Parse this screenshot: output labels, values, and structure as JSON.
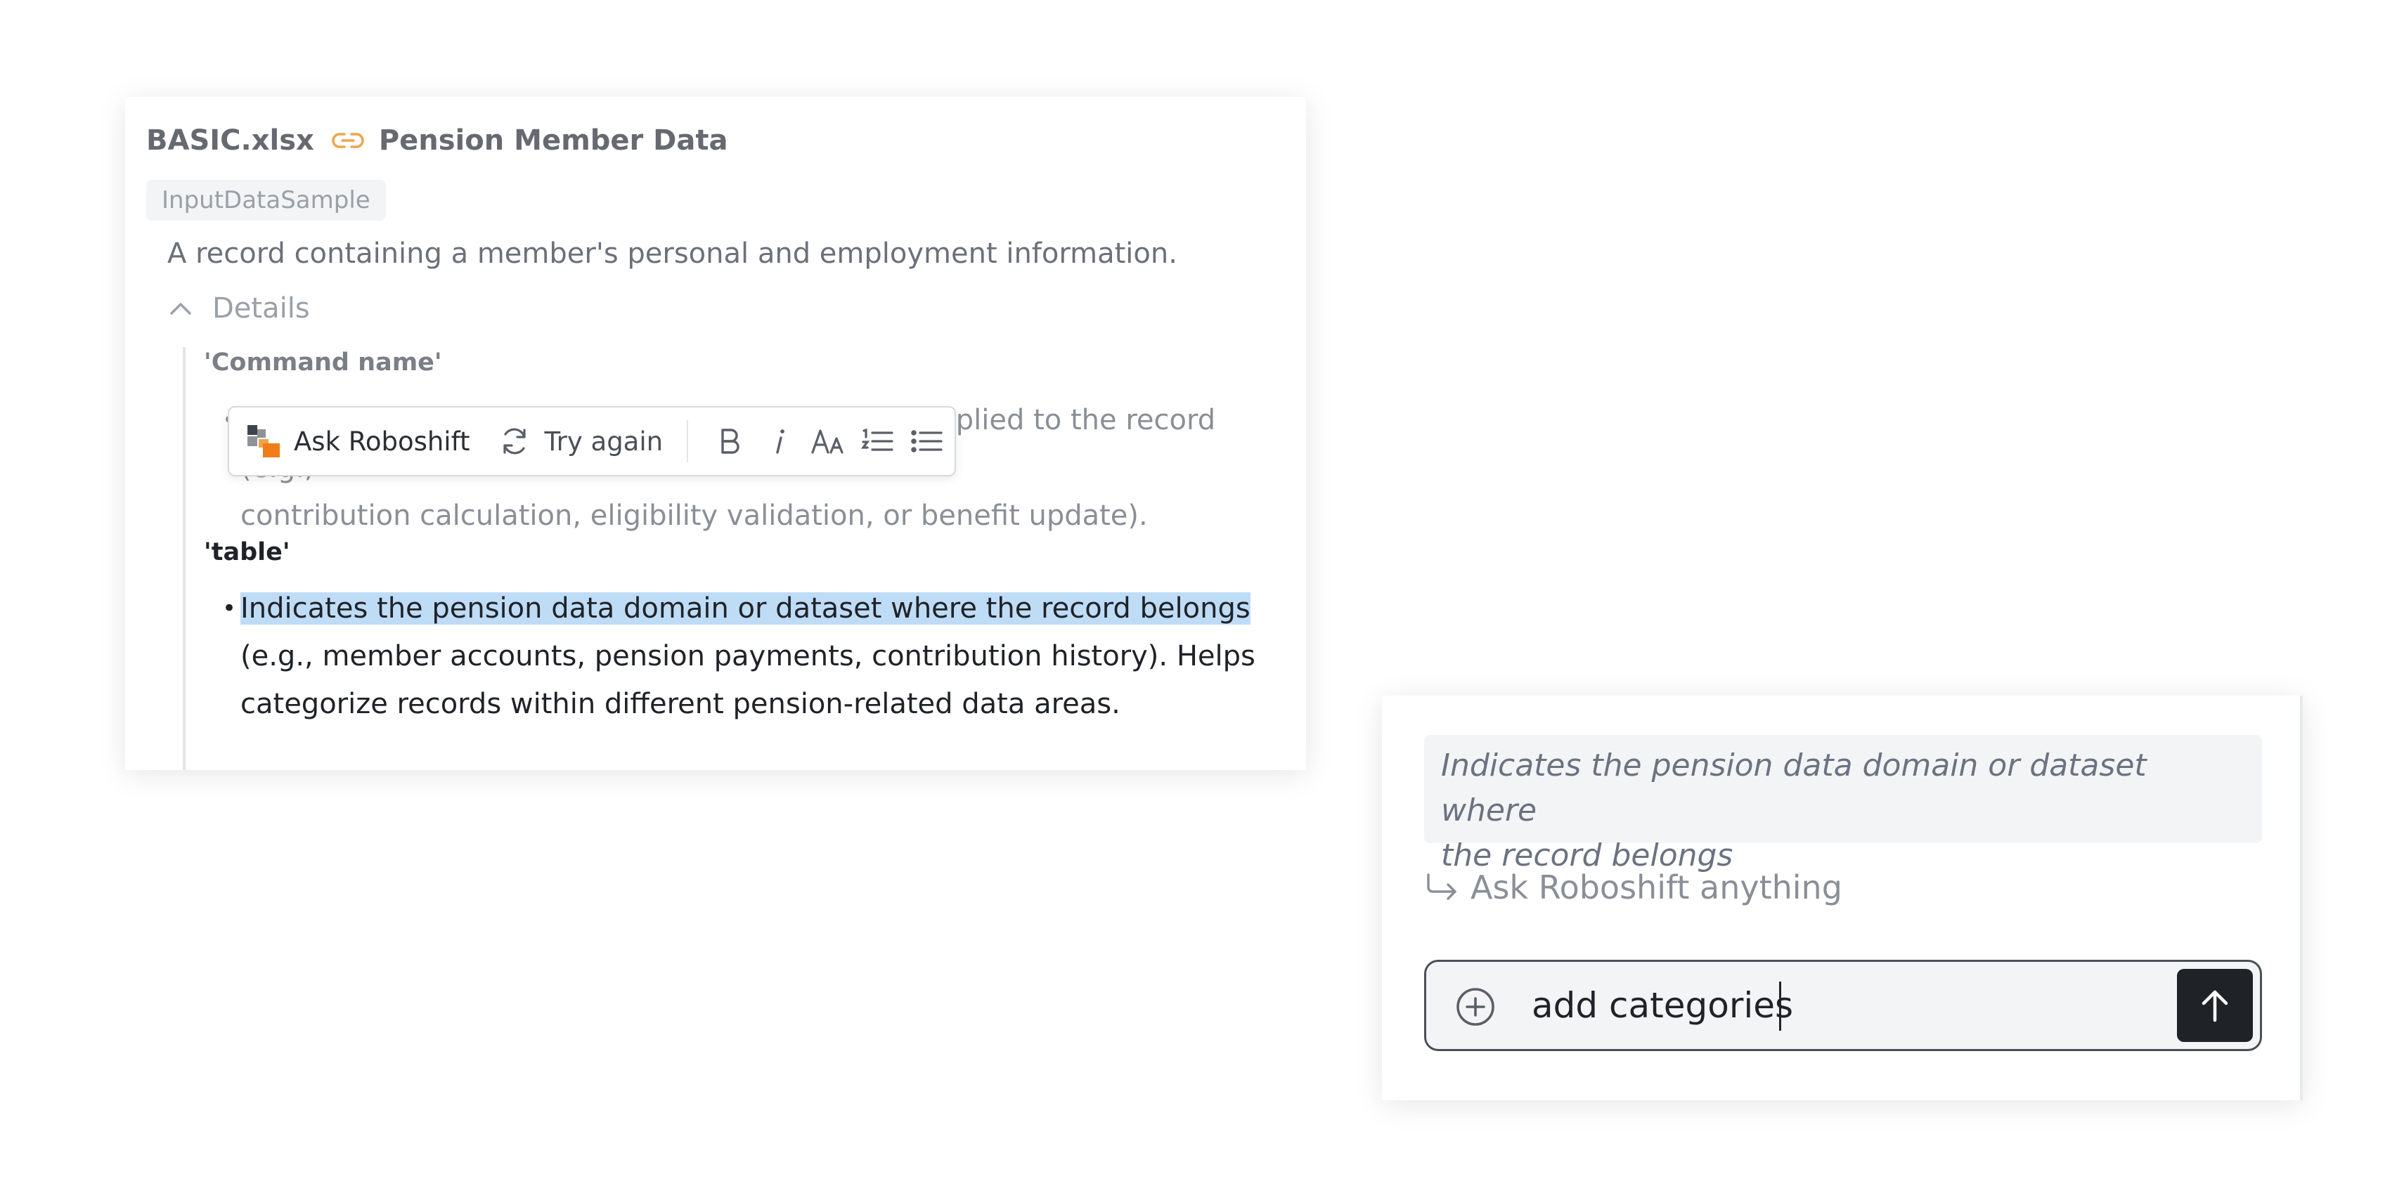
{
  "card": {
    "filename": "BASIC.xlsx",
    "dataset_title": "Pension Member Data",
    "chip_label": "InputDataSample",
    "description": "A record containing a member's personal and employment information.",
    "details_label": "Details",
    "fields": [
      {
        "name": "'Command name'",
        "bullet_line1": "Represents the pension-related processing step applied to the record (e.g.,",
        "bullet_line2": "contribution calculation, eligibility validation, or benefit update)."
      },
      {
        "name": "'table'",
        "bullet_highlight": "Indicates the pension data domain or dataset where the record belongs",
        "bullet_line2": "(e.g., member accounts, pension payments, contribution history). Helps",
        "bullet_line3": "categorize records within different pension-related data areas."
      }
    ]
  },
  "toolbar": {
    "ask_label": "Ask Roboshift",
    "try_again_label": "Try again",
    "buttons": [
      "bold",
      "italic",
      "font-size",
      "numbered-list",
      "bulleted-list"
    ]
  },
  "panel": {
    "quoted_text_line1": "Indicates the pension data domain or dataset where",
    "quoted_text_line2": "the record belongs",
    "ask_anything_label": "Ask Roboshift anything",
    "input_value": "add categories"
  },
  "colors": {
    "accent_orange": "#f0a44b",
    "logo_orange": "#f07d1a",
    "highlight": "#bfdcf7",
    "send_button": "#1f2328"
  }
}
